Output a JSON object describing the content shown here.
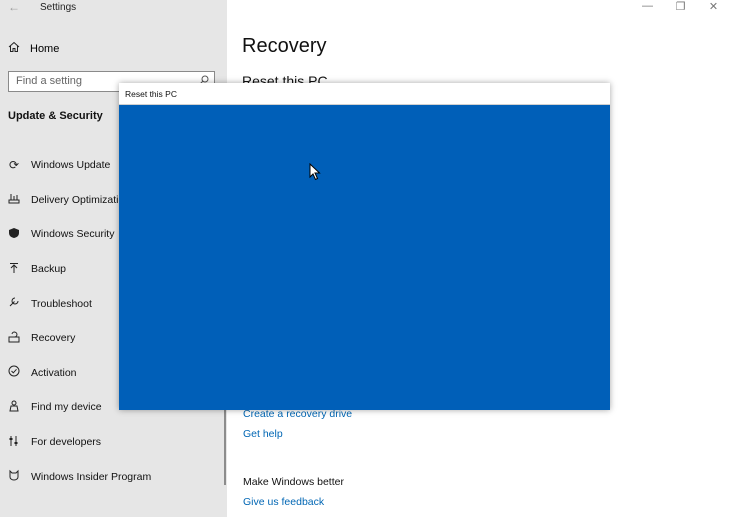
{
  "window": {
    "title": "Settings",
    "back_glyph": "←",
    "controls": {
      "minimize": "—",
      "maximize": "❐",
      "close": "✕"
    }
  },
  "sidebar": {
    "home_label": "Home",
    "search_placeholder": "Find a setting",
    "section_title": "Update & Security",
    "items": [
      {
        "label": "Windows Update",
        "icon": "refresh-icon"
      },
      {
        "label": "Delivery Optimization",
        "icon": "delivery-icon"
      },
      {
        "label": "Windows Security",
        "icon": "shield-icon"
      },
      {
        "label": "Backup",
        "icon": "backup-arrow-icon"
      },
      {
        "label": "Troubleshoot",
        "icon": "wrench-icon"
      },
      {
        "label": "Recovery",
        "icon": "recovery-icon"
      },
      {
        "label": "Activation",
        "icon": "check-circle-icon"
      },
      {
        "label": "Find my device",
        "icon": "person-location-icon"
      },
      {
        "label": "For developers",
        "icon": "developer-sliders-icon"
      },
      {
        "label": "Windows Insider Program",
        "icon": "insider-cat-icon"
      }
    ]
  },
  "main": {
    "title": "Recovery",
    "reset_heading": "Reset this PC",
    "create_recovery_drive": "Create a recovery drive",
    "get_help": "Get help",
    "make_windows_better": "Make Windows better",
    "give_feedback": "Give us feedback"
  },
  "dialog": {
    "title": "Reset this PC",
    "body_color": "#005fb8"
  }
}
